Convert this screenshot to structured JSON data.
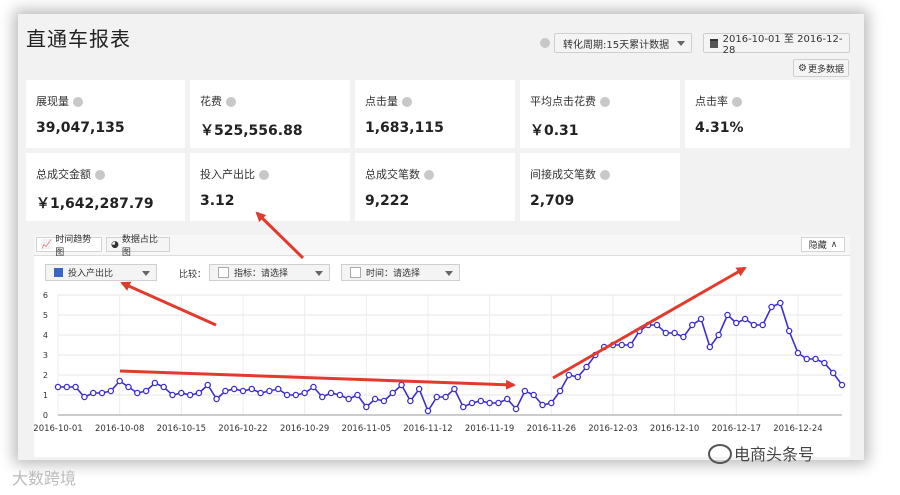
{
  "header": {
    "title": "直通车报表",
    "period_label": "转化周期:15天累计数据",
    "date_range": "2016-10-01 至 2016-12-28",
    "more_data_label": "更多数据"
  },
  "metrics": [
    {
      "label": "展现量",
      "value": "39,047,135"
    },
    {
      "label": "花费",
      "value": "￥525,556.88"
    },
    {
      "label": "点击量",
      "value": "1,683,115"
    },
    {
      "label": "平均点击花费",
      "value": "￥0.31"
    },
    {
      "label": "点击率",
      "value": "4.31%"
    },
    {
      "label": "总成交金额",
      "value": "￥1,642,287.79"
    },
    {
      "label": "投入产出比",
      "value": "3.12"
    },
    {
      "label": "总成交笔数",
      "value": "9,222"
    },
    {
      "label": "间接成交笔数",
      "value": "2,709"
    }
  ],
  "chart_panel": {
    "tab_trend": "时间趋势图",
    "tab_share": "数据占比图",
    "hide_label": "隐藏",
    "metric_select": "投入产出比",
    "compare_label": "比较：",
    "indicator_select": "指标：请选择",
    "time_select": "时间：请选择"
  },
  "chart_data": {
    "type": "line",
    "ylim": [
      0,
      6
    ],
    "yticks": [
      "0",
      "1",
      "2",
      "3",
      "4",
      "5",
      "6"
    ],
    "x_tick_labels": [
      "2016-10-01",
      "2016-10-08",
      "2016-10-15",
      "2016-10-22",
      "2016-10-29",
      "2016-11-05",
      "2016-11-12",
      "2016-11-19",
      "2016-11-26",
      "2016-12-03",
      "2016-12-10",
      "2016-12-17",
      "2016-12-24"
    ],
    "x_start": "2016-10-01",
    "series": [
      {
        "name": "投入产出比",
        "color": "#3b2fd0",
        "values": [
          1.4,
          1.4,
          1.4,
          0.9,
          1.1,
          1.1,
          1.2,
          1.7,
          1.4,
          1.1,
          1.2,
          1.6,
          1.4,
          1.0,
          1.1,
          1.0,
          1.1,
          1.5,
          0.8,
          1.2,
          1.3,
          1.2,
          1.3,
          1.1,
          1.2,
          1.3,
          1.0,
          1.0,
          1.1,
          1.4,
          0.9,
          1.1,
          1.0,
          0.8,
          1.0,
          0.4,
          0.8,
          0.7,
          1.1,
          1.5,
          0.7,
          1.3,
          0.2,
          0.9,
          0.9,
          1.3,
          0.4,
          0.6,
          0.7,
          0.6,
          0.6,
          0.8,
          0.3,
          1.2,
          1.0,
          0.5,
          0.6,
          1.2,
          2.0,
          1.9,
          2.4,
          3.0,
          3.4,
          3.5,
          3.5,
          3.5,
          4.2,
          4.5,
          4.5,
          4.1,
          4.1,
          3.9,
          4.5,
          4.8,
          3.4,
          4.0,
          5.0,
          4.6,
          4.8,
          4.5,
          4.5,
          5.4,
          5.6,
          4.2,
          3.1,
          2.8,
          2.8,
          2.6,
          2.1,
          1.5
        ]
      }
    ],
    "grid": true
  },
  "watermarks": {
    "left": "大数跨境",
    "right": "电商头条号"
  },
  "colors": {
    "line": "#3b2fd0",
    "arrow": "#e23b2e"
  }
}
